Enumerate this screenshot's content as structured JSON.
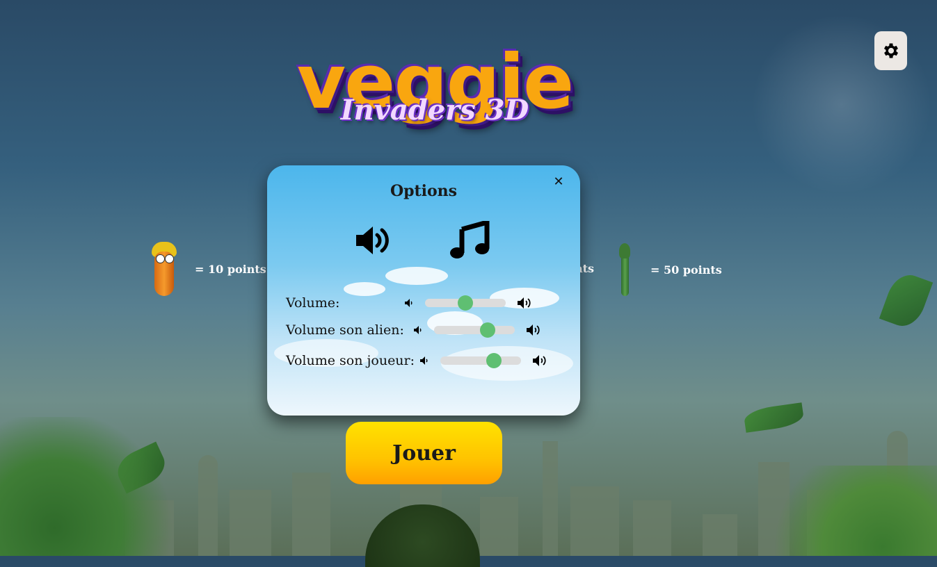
{
  "logo": {
    "title": "veggie",
    "subtitle": "Invaders 3D"
  },
  "settings": {
    "icon": "gear-icon"
  },
  "legend": [
    {
      "icon": "carrot-alien-icon",
      "label": "= 10 points"
    },
    {
      "icon": "unknown-alien-icon",
      "label": "nts"
    },
    {
      "icon": "asparagus-alien-icon",
      "label": "= 50 points"
    }
  ],
  "options": {
    "title": "Options",
    "close_label": "✕",
    "sound_icon": "speaker-icon",
    "music_icon": "music-note-icon",
    "sliders": [
      {
        "label": "Volume:",
        "value": 0.5
      },
      {
        "label": "Volume son alien:",
        "value": 0.66
      },
      {
        "label": "Volume son joueur:",
        "value": 0.66
      }
    ]
  },
  "play": {
    "label": "Jouer"
  },
  "colors": {
    "accent": "#ffc300",
    "slider_thumb": "#5fbf72",
    "modal_top": "#4cb6ec"
  }
}
